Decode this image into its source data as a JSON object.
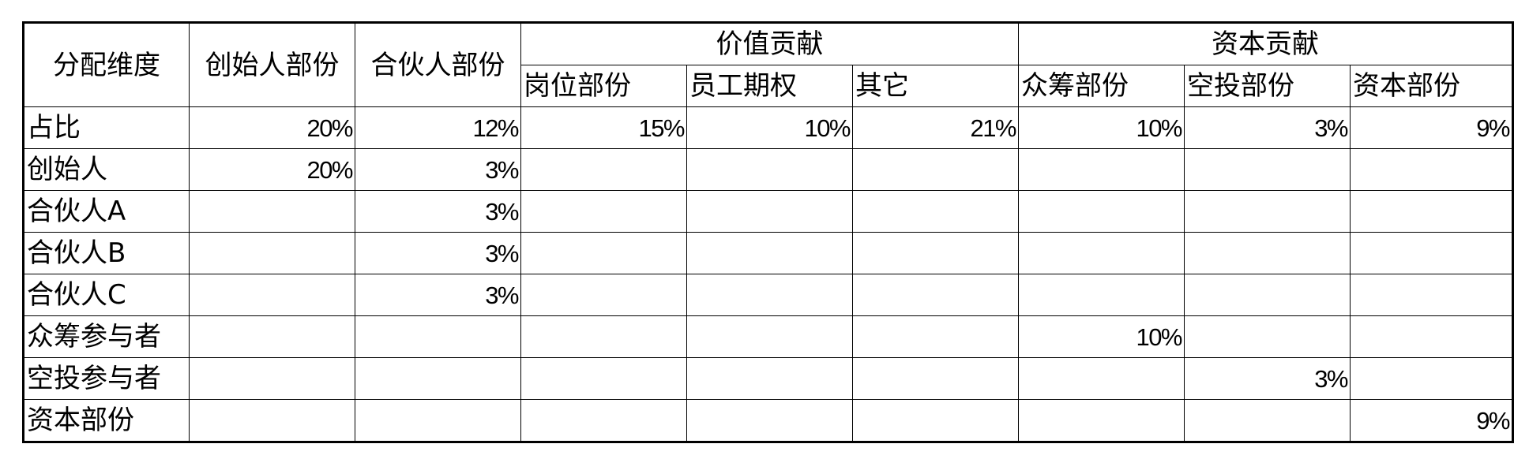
{
  "table": {
    "headers": {
      "dimension": "分配维度",
      "founder_part": "创始人部份",
      "partner_part": "合伙人部份",
      "value_contribution": "价值贡献",
      "capital_contribution": "资本贡献",
      "sub": [
        "岗位部份",
        "员工期权",
        "其它",
        "众筹部份",
        "空投部份",
        "资本部份"
      ]
    },
    "rows": [
      {
        "label": "占比",
        "cells": [
          "20%",
          "12%",
          "15%",
          "10%",
          "21%",
          "10%",
          "3%",
          "9%"
        ]
      },
      {
        "label": "创始人",
        "cells": [
          "20%",
          "3%",
          "",
          "",
          "",
          "",
          "",
          ""
        ]
      },
      {
        "label": "合伙人A",
        "cells": [
          "",
          "3%",
          "",
          "",
          "",
          "",
          "",
          ""
        ]
      },
      {
        "label": "合伙人B",
        "cells": [
          "",
          "3%",
          "",
          "",
          "",
          "",
          "",
          ""
        ]
      },
      {
        "label": "合伙人C",
        "cells": [
          "",
          "3%",
          "",
          "",
          "",
          "",
          "",
          ""
        ]
      },
      {
        "label": "众筹参与者",
        "cells": [
          "",
          "",
          "",
          "",
          "",
          "10%",
          "",
          ""
        ]
      },
      {
        "label": "空投参与者",
        "cells": [
          "",
          "",
          "",
          "",
          "",
          "",
          "3%",
          ""
        ]
      },
      {
        "label": "资本部份",
        "cells": [
          "",
          "",
          "",
          "",
          "",
          "",
          "",
          "9%"
        ]
      }
    ]
  }
}
